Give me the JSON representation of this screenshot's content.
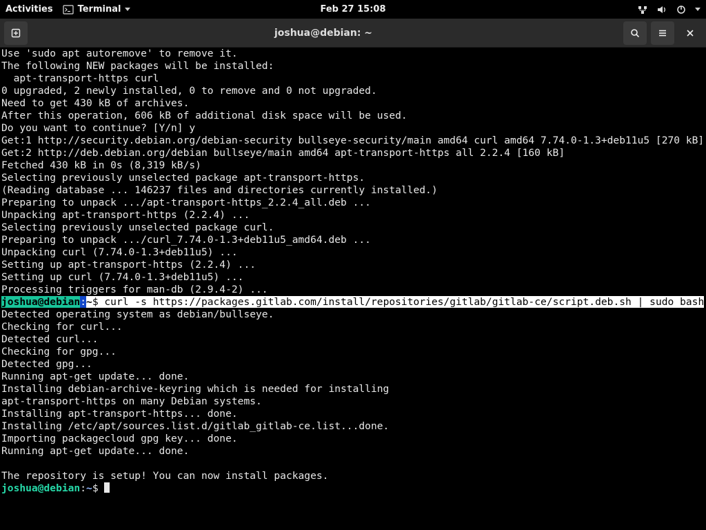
{
  "topbar": {
    "activities": "Activities",
    "app_name": "Terminal",
    "clock": "Feb 27  15:08"
  },
  "titlebar": {
    "title": "joshua@debian: ~"
  },
  "terminal": {
    "pre_lines": [
      "Use 'sudo apt autoremove' to remove it.",
      "The following NEW packages will be installed:",
      "  apt-transport-https curl",
      "0 upgraded, 2 newly installed, 0 to remove and 0 not upgraded.",
      "Need to get 430 kB of archives.",
      "After this operation, 606 kB of additional disk space will be used.",
      "Do you want to continue? [Y/n] y",
      "Get:1 http://security.debian.org/debian-security bullseye-security/main amd64 curl amd64 7.74.0-1.3+deb11u5 [270 kB]",
      "Get:2 http://deb.debian.org/debian bullseye/main amd64 apt-transport-https all 2.2.4 [160 kB]",
      "Fetched 430 kB in 0s (8,319 kB/s)",
      "Selecting previously unselected package apt-transport-https.",
      "(Reading database ... 146237 files and directories currently installed.)",
      "Preparing to unpack .../apt-transport-https_2.2.4_all.deb ...",
      "Unpacking apt-transport-https (2.2.4) ...",
      "Selecting previously unselected package curl.",
      "Preparing to unpack .../curl_7.74.0-1.3+deb11u5_amd64.deb ...",
      "Unpacking curl (7.74.0-1.3+deb11u5) ...",
      "Setting up apt-transport-https (2.2.4) ...",
      "Setting up curl (7.74.0-1.3+deb11u5) ...",
      "Processing triggers for man-db (2.9.4-2) ..."
    ],
    "hl_prompt": {
      "userhost": "joshua@debian",
      "colon": ":",
      "path": "~",
      "cmd": "$ curl -s https://packages.gitlab.com/install/repositories/gitlab/gitlab-ce/script.deb.sh | sudo bash"
    },
    "post_lines": [
      "Detected operating system as debian/bullseye.",
      "Checking for curl...",
      "Detected curl...",
      "Checking for gpg...",
      "Detected gpg...",
      "Running apt-get update... done.",
      "Installing debian-archive-keyring which is needed for installing",
      "apt-transport-https on many Debian systems.",
      "Installing apt-transport-https... done.",
      "Installing /etc/apt/sources.list.d/gitlab_gitlab-ce.list...done.",
      "Importing packagecloud gpg key... done.",
      "Running apt-get update... done.",
      "",
      "The repository is setup! You can now install packages."
    ],
    "prompt2": {
      "userhost": "joshua@debian",
      "colon": ":",
      "path": "~",
      "dollar": "$ "
    }
  }
}
